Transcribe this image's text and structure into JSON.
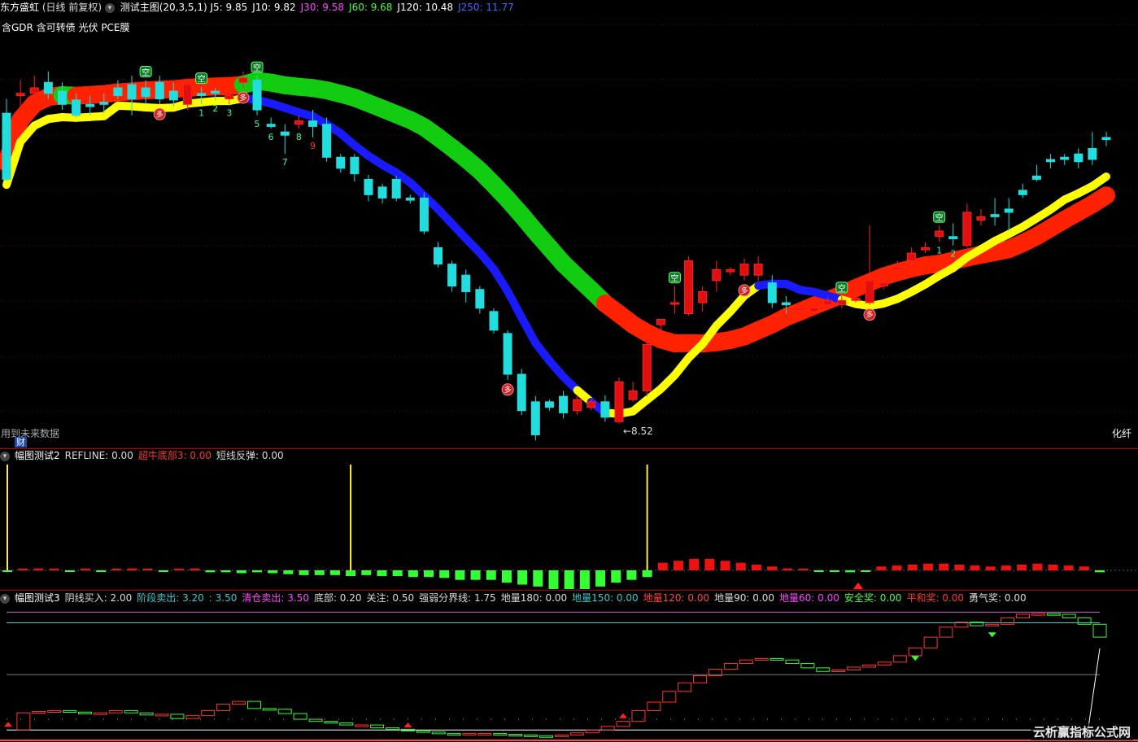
{
  "main": {
    "stock_name": "东方盛虹",
    "period": "(日线 前复权)",
    "indicator": "测试主图(20,3,5,1)",
    "values": [
      {
        "label": "J5: 9.85",
        "color": "#ffffff"
      },
      {
        "label": "J10: 9.82",
        "color": "#ffffff"
      },
      {
        "label": "J30: 9.58",
        "color": "#ff44ff"
      },
      {
        "label": "J60: 9.68",
        "color": "#44ff44"
      },
      {
        "label": "J120: 10.48",
        "color": "#ffffff"
      },
      {
        "label": "J250: 11.77",
        "color": "#4466ff"
      }
    ],
    "concepts": "含GDR 含可转债 光伏 PCE膜",
    "note_left": "用到未来数据",
    "cai_badge": "财",
    "note_right": "化纤",
    "low_label": "←8.52",
    "marker_kong": "空",
    "marker_duo": "多"
  },
  "panel2": {
    "title": "幅图测试2",
    "values": [
      {
        "label": "REFLINE: 0.00",
        "color": "#dddddd"
      },
      {
        "label": "超牛底部3: 0.00",
        "color": "#ff3333"
      },
      {
        "label": "短线反弹: 0.00",
        "color": "#dddddd"
      }
    ]
  },
  "panel3": {
    "title": "幅图测试3",
    "values": [
      {
        "label": "阴线买入: 2.00",
        "color": "#dddddd"
      },
      {
        "label": "阶段卖出: 3.20",
        "color": "#33cccc"
      },
      {
        "label": ": 3.50",
        "color": "#33cccc"
      },
      {
        "label": "清仓卖出: 3.50",
        "color": "#ff44ff"
      },
      {
        "label": "底部: 0.20",
        "color": "#dddddd"
      },
      {
        "label": "关注: 0.50",
        "color": "#dddddd"
      },
      {
        "label": "强弱分界线: 1.75",
        "color": "#dddddd"
      },
      {
        "label": "地量180: 0.00",
        "color": "#dddddd"
      },
      {
        "label": "地量150: 0.00",
        "color": "#33cccc"
      },
      {
        "label": "地量120: 0.00",
        "color": "#ff4444"
      },
      {
        "label": "地量90: 0.00",
        "color": "#dddddd"
      },
      {
        "label": "地量60: 0.00",
        "color": "#ff44ff"
      },
      {
        "label": "安全奖: 0.00",
        "color": "#44ff44"
      },
      {
        "label": "平和奖: 0.00",
        "color": "#ff3333"
      },
      {
        "label": "勇气奖: 0.00",
        "color": "#dddddd"
      }
    ]
  },
  "watermark": "云析赢指标公式网",
  "chart_data": [
    {
      "type": "candlestick",
      "title": "测试主图(20,3,5,1)",
      "ylim": [
        8.3,
        12.2
      ],
      "low_annotation": 8.52,
      "candles": [
        [
          11.32,
          10.72,
          11.45,
          10.7
        ],
        [
          11.48,
          11.5,
          11.62,
          11.38
        ],
        [
          11.5,
          11.55,
          11.66,
          11.35
        ],
        [
          11.6,
          11.5,
          11.7,
          11.45
        ],
        [
          11.52,
          11.4,
          11.6,
          11.35
        ],
        [
          11.44,
          11.3,
          11.5,
          11.28
        ],
        [
          11.4,
          11.38,
          11.48,
          11.3
        ],
        [
          11.42,
          11.4,
          11.5,
          11.32
        ],
        [
          11.55,
          11.48,
          11.62,
          11.45
        ],
        [
          11.58,
          11.45,
          11.66,
          11.3
        ],
        [
          11.55,
          11.47,
          11.62,
          11.4
        ],
        [
          11.6,
          11.45,
          11.66,
          11.4
        ],
        [
          11.52,
          11.44,
          11.6,
          11.38
        ],
        [
          11.4,
          11.58,
          11.62,
          11.35
        ],
        [
          11.5,
          11.48,
          11.56,
          11.4
        ],
        [
          11.52,
          11.5,
          11.55,
          11.44
        ],
        [
          11.45,
          11.48,
          11.52,
          11.4
        ],
        [
          11.6,
          11.64,
          11.7,
          11.55
        ],
        [
          11.62,
          11.35,
          11.66,
          11.3
        ],
        [
          11.22,
          11.2,
          11.28,
          11.18
        ],
        [
          11.15,
          11.12,
          11.22,
          10.95
        ],
        [
          11.22,
          11.25,
          11.3,
          11.18
        ],
        [
          11.25,
          11.2,
          11.35,
          11.1
        ],
        [
          11.22,
          10.92,
          11.28,
          10.88
        ],
        [
          10.92,
          10.82,
          10.95,
          10.78
        ],
        [
          10.92,
          10.77,
          10.95,
          10.7
        ],
        [
          10.72,
          10.58,
          10.76,
          10.52
        ],
        [
          10.65,
          10.55,
          10.68,
          10.5
        ],
        [
          10.72,
          10.55,
          10.75,
          10.52
        ],
        [
          10.55,
          10.53,
          10.58,
          10.5
        ],
        [
          10.55,
          10.25,
          10.6,
          10.22
        ],
        [
          10.1,
          9.95,
          10.15,
          9.92
        ],
        [
          9.95,
          9.75,
          9.98,
          9.7
        ],
        [
          9.85,
          9.7,
          9.9,
          9.6
        ],
        [
          9.72,
          9.55,
          9.75,
          9.5
        ],
        [
          9.52,
          9.35,
          9.55,
          9.32
        ],
        [
          9.32,
          8.95,
          9.35,
          8.9
        ],
        [
          8.95,
          8.62,
          9.0,
          8.58
        ],
        [
          8.7,
          8.4,
          8.75,
          8.35
        ],
        [
          8.7,
          8.65,
          8.72,
          8.62
        ],
        [
          8.75,
          8.6,
          8.8,
          8.55
        ],
        [
          8.62,
          8.72,
          8.76,
          8.58
        ],
        [
          8.65,
          8.7,
          8.72,
          8.62
        ],
        [
          8.7,
          8.56,
          8.76,
          8.52
        ],
        [
          8.52,
          8.88,
          8.92,
          8.5
        ],
        [
          8.72,
          8.8,
          8.88,
          8.7
        ],
        [
          8.8,
          9.22,
          9.25,
          8.75
        ],
        [
          9.4,
          9.45,
          9.45,
          9.25
        ],
        [
          9.6,
          9.6,
          9.75,
          9.5
        ],
        [
          9.5,
          9.98,
          10.02,
          9.48
        ],
        [
          9.6,
          9.7,
          9.75,
          9.52
        ],
        [
          9.8,
          9.9,
          9.98,
          9.7
        ],
        [
          9.88,
          9.9,
          9.92,
          9.85
        ],
        [
          9.85,
          9.95,
          10.0,
          9.8
        ],
        [
          9.85,
          9.95,
          10.02,
          9.8
        ],
        [
          9.78,
          9.6,
          9.85,
          9.55
        ],
        [
          9.6,
          9.58,
          9.66,
          9.5
        ],
        [
          9.55,
          9.55,
          9.6,
          9.5
        ],
        [
          9.52,
          9.55,
          9.58,
          9.48
        ],
        [
          9.58,
          9.62,
          9.65,
          9.55
        ],
        [
          9.58,
          9.62,
          9.66,
          9.55
        ],
        [
          9.62,
          9.64,
          9.68,
          9.6
        ],
        [
          9.6,
          9.8,
          10.3,
          9.58
        ],
        [
          9.75,
          9.78,
          9.85,
          9.72
        ],
        [
          9.9,
          9.92,
          9.98,
          9.85
        ],
        [
          9.98,
          10.05,
          10.1,
          9.92
        ],
        [
          10.08,
          10.1,
          10.15,
          10.05
        ],
        [
          10.2,
          10.25,
          10.3,
          10.15
        ],
        [
          10.2,
          10.18,
          10.32,
          10.12
        ],
        [
          10.12,
          10.42,
          10.5,
          10.1
        ],
        [
          10.35,
          10.38,
          10.45,
          10.3
        ],
        [
          10.4,
          10.38,
          10.55,
          10.3
        ],
        [
          10.45,
          10.42,
          10.55,
          10.25
        ],
        [
          10.62,
          10.58,
          10.68,
          10.55
        ],
        [
          10.75,
          10.72,
          10.85,
          10.7
        ],
        [
          10.9,
          10.88,
          10.95,
          10.82
        ],
        [
          10.92,
          10.9,
          10.95,
          10.85
        ],
        [
          10.95,
          10.88,
          11.0,
          10.82
        ],
        [
          11.0,
          10.9,
          11.15,
          10.85
        ],
        [
          11.1,
          11.08,
          11.15,
          11.02
        ]
      ]
    },
    {
      "type": "bar",
      "title": "幅图测试2",
      "series": [
        {
          "name": "短线反弹",
          "values": [
            -0.01,
            0.01,
            0.02,
            0.01,
            -0.01,
            0.01,
            -0.01,
            0.01,
            0.02,
            0.01,
            -0.01,
            0.01,
            0.02,
            -0.02,
            -0.02,
            -0.03,
            -0.02,
            -0.03,
            -0.04,
            -0.05,
            -0.05,
            -0.05,
            -0.06,
            -0.05,
            -0.06,
            -0.06,
            -0.07,
            -0.07,
            -0.08,
            -0.1,
            -0.1,
            -0.1,
            -0.13,
            -0.15,
            -0.17,
            -0.2,
            -0.23,
            -0.2,
            -0.17,
            -0.13,
            -0.1,
            -0.07,
            0.08,
            0.1,
            0.12,
            0.12,
            0.1,
            0.08,
            0.06,
            0.04,
            0.02,
            0.01,
            -0.01,
            -0.01,
            -0.02,
            -0.01,
            0.04,
            0.05,
            0.06,
            0.07,
            0.07,
            0.06,
            0.05,
            0.04,
            0.05,
            0.06,
            0.07,
            0.06,
            0.05,
            0.04,
            -0.02
          ]
        }
      ],
      "spikes": [
        0,
        22,
        41
      ],
      "spike_value": 1.0
    },
    {
      "type": "line",
      "title": "幅图测试3",
      "reference_lines": [
        {
          "name": "清仓卖出",
          "value": 3.5,
          "color": "#cc66cc"
        },
        {
          "name": "阶段卖出",
          "value": 3.2,
          "color": "#33cccc"
        },
        {
          "name": "强弱分界线",
          "value": 1.75,
          "color": "#777777"
        },
        {
          "name": "关注",
          "value": 0.5,
          "color": "#aaaaaa"
        },
        {
          "name": "底部",
          "value": 0.2,
          "color": "#ffffff"
        }
      ],
      "values": [
        0.2,
        0.68,
        0.72,
        0.74,
        0.7,
        0.66,
        0.68,
        0.74,
        0.68,
        0.62,
        0.64,
        0.52,
        0.6,
        0.74,
        0.92,
        1.0,
        0.8,
        0.78,
        0.66,
        0.5,
        0.44,
        0.4,
        0.34,
        0.34,
        0.26,
        0.22,
        0.18,
        0.14,
        0.1,
        0.08,
        0.1,
        0.1,
        0.08,
        0.06,
        0.04,
        0.02,
        0.06,
        0.12,
        0.2,
        0.3,
        0.44,
        0.74,
        0.98,
        1.28,
        1.52,
        1.72,
        1.9,
        2.06,
        2.16,
        2.2,
        2.16,
        2.06,
        1.94,
        1.84,
        1.88,
        1.96,
        2.02,
        2.1,
        2.28,
        2.5,
        2.8,
        3.08,
        3.22,
        3.12,
        3.16,
        3.34,
        3.44,
        3.46,
        3.44,
        3.34,
        3.16,
        2.8
      ]
    }
  ]
}
